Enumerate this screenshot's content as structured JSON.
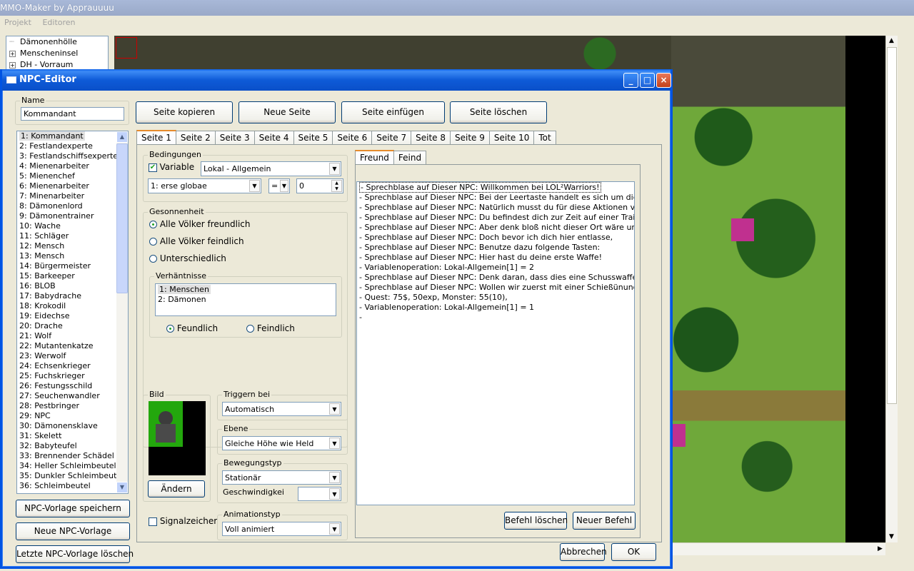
{
  "app": {
    "title": "MMO-Maker by Apprauuuu",
    "menu": [
      "Projekt",
      "Editoren"
    ]
  },
  "tree": [
    {
      "label": "Dämonenhölle",
      "expandable": false
    },
    {
      "label": "Menscheninsel",
      "expandable": true
    },
    {
      "label": "DH - Vorraum",
      "expandable": true
    }
  ],
  "window": {
    "title": "NPC-Editor",
    "name_label": "Name",
    "name_value": "Kommandant",
    "page_buttons": [
      "Seite kopieren",
      "Neue Seite",
      "Seite einfügen",
      "Seite löschen"
    ],
    "npc_list": [
      "1: Kommandant",
      "2: Festlandexperte",
      "3: Festlandschiffsexperte",
      "4: Mienenarbeiter",
      "5: Mienenchef",
      "6: Mienenarbeiter",
      "7: Minenarbeiter",
      "8: Dämonenlord",
      "9: Dämonentrainer",
      "10: Wache",
      "11: Schläger",
      "12: Mensch",
      "13: Mensch",
      "14: Bürgermeister",
      "15: Barkeeper",
      "16: BLOB",
      "17: Babydrache",
      "18: Krokodil",
      "19: Eidechse",
      "20: Drache",
      "21: Wolf",
      "22: Mutantenkatze",
      "23: Werwolf",
      "24: Echsenkrieger",
      "25: Fuchskrieger",
      "26: Festungsschild",
      "27: Seuchenwandler",
      "28: Pestbringer",
      "29: NPC",
      "30: Dämonensklave",
      "31: Skelett",
      "32: Babyteufel",
      "33: Brennender Schädel",
      "34: Heller Schleimbeutel",
      "35: Dunkler Schleimbeutel",
      "36: Schleimbeutel"
    ],
    "npc_list_selected": 0,
    "bottom_buttons": [
      "NPC-Vorlage speichern",
      "Neue NPC-Vorlage",
      "Letzte NPC-Vorlage löschen"
    ],
    "tabs": [
      "Seite 1",
      "Seite 2",
      "Seite 3",
      "Seite 4",
      "Seite 5",
      "Seite 6",
      "Seite 7",
      "Seite 8",
      "Seite 9",
      "Seite 10",
      "Tot"
    ],
    "active_tab": 0,
    "bedingungen": {
      "caption": "Bedingungen",
      "variable_label": "Variable",
      "variable_checked": true,
      "scope": "Lokal - Allgemein",
      "var_name": "1: erse globae",
      "operator": "=",
      "value": "0"
    },
    "gesonnenheit": {
      "caption": "Gesonnenheit",
      "options": [
        "Alle Völker freundlich",
        "Alle Völker feindlich",
        "Unterschiedlich"
      ],
      "selected": 0,
      "verhaeltnisse": {
        "caption": "Verhäntnisse",
        "items": [
          "1: Menschen",
          "2: Dämonen"
        ],
        "radio": [
          "Feundlich",
          "Feindlich"
        ],
        "radio_selected": 0
      }
    },
    "bild": {
      "caption": "Bild",
      "change_button": "Ändern"
    },
    "signal_label": "Signalzeicher",
    "triggern": {
      "caption": "Triggern bei",
      "value": "Automatisch"
    },
    "ebene": {
      "caption": "Ebene",
      "value": "Gleiche Höhe wie Held"
    },
    "bewegung": {
      "caption": "Bewegungstyp",
      "value": "Stationär",
      "speed_label": "Geschwindigkei",
      "speed_value": ""
    },
    "animation": {
      "caption": "Animationstyp",
      "value": "Voll animiert"
    },
    "inner_tabs": [
      "Freund",
      "Feind"
    ],
    "inner_active": 0,
    "commands": [
      "- Sprechblase auf Dieser NPC: Willkommen bei LOL²Warriors!",
      "- Sprechblase auf Dieser NPC: Bei der Leertaste handelt es sich um die allgem...",
      "- Sprechblase auf Dieser NPC: Natürlich musst du für diese Aktionen vor",
      "- Sprechblase auf Dieser NPC: Du befindest dich zur Zeit auf einer Trainingsinsel,",
      "- Sprechblase auf Dieser NPC: Aber denk bloß nicht dieser Ort wäre ungefährli...",
      "- Sprechblase auf Dieser NPC: Doch bevor ich dich hier entlasse,",
      "- Sprechblase auf Dieser NPC: Benutze dazu folgende Tasten:",
      "- Sprechblase auf Dieser NPC: Hier hast du deine erste Waffe!",
      "- Variablenoperation: Lokal-Allgemein[1] = 2",
      "- Sprechblase auf Dieser NPC: Denk daran, dass dies eine Schusswaffe ist,",
      "- Sprechblase auf Dieser NPC: Wollen wir zuerst mit einer Schießünung beginn...",
      "- Quest: 75$, 50exp, Monster: 55(10),",
      "- Variablenoperation: Lokal-Allgemein[1] = 1",
      "-"
    ],
    "command_buttons": [
      "Befehl löschen",
      "Neuer Befehl"
    ],
    "dialog_buttons": [
      "Abbrechen",
      "OK"
    ]
  }
}
